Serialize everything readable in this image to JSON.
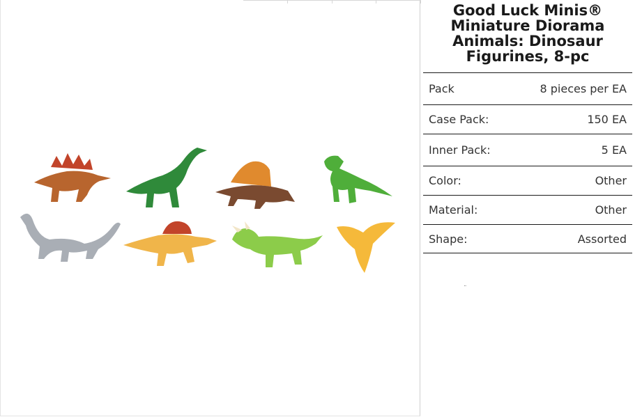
{
  "product": {
    "title": "Good Luck Minis® Miniature Diorama Animals: Dinosaur Figurines, 8-pc"
  },
  "specs": [
    {
      "label": "Pack",
      "value": "8 pieces per EA"
    },
    {
      "label": "Case Pack:",
      "value": "150 EA"
    },
    {
      "label": "Inner Pack:",
      "value": "5 EA"
    },
    {
      "label": "Color:",
      "value": "Other"
    },
    {
      "label": "Material:",
      "value": "Other"
    },
    {
      "label": "Shape:",
      "value": "Assorted"
    }
  ],
  "figures": [
    {
      "name": "stegosaurus",
      "color": "#b8652e"
    },
    {
      "name": "brachiosaurus",
      "color": "#2f8a3a"
    },
    {
      "name": "dimetrodon",
      "color": "#e08a2e"
    },
    {
      "name": "dilophosaurus",
      "color": "#4fae3a"
    },
    {
      "name": "apatosaurus",
      "color": "#a9aeb5"
    },
    {
      "name": "spinosaurus",
      "color": "#f0b54a"
    },
    {
      "name": "triceratops",
      "color": "#8ccc4a"
    },
    {
      "name": "pteranodon",
      "color": "#f5b93a"
    }
  ]
}
